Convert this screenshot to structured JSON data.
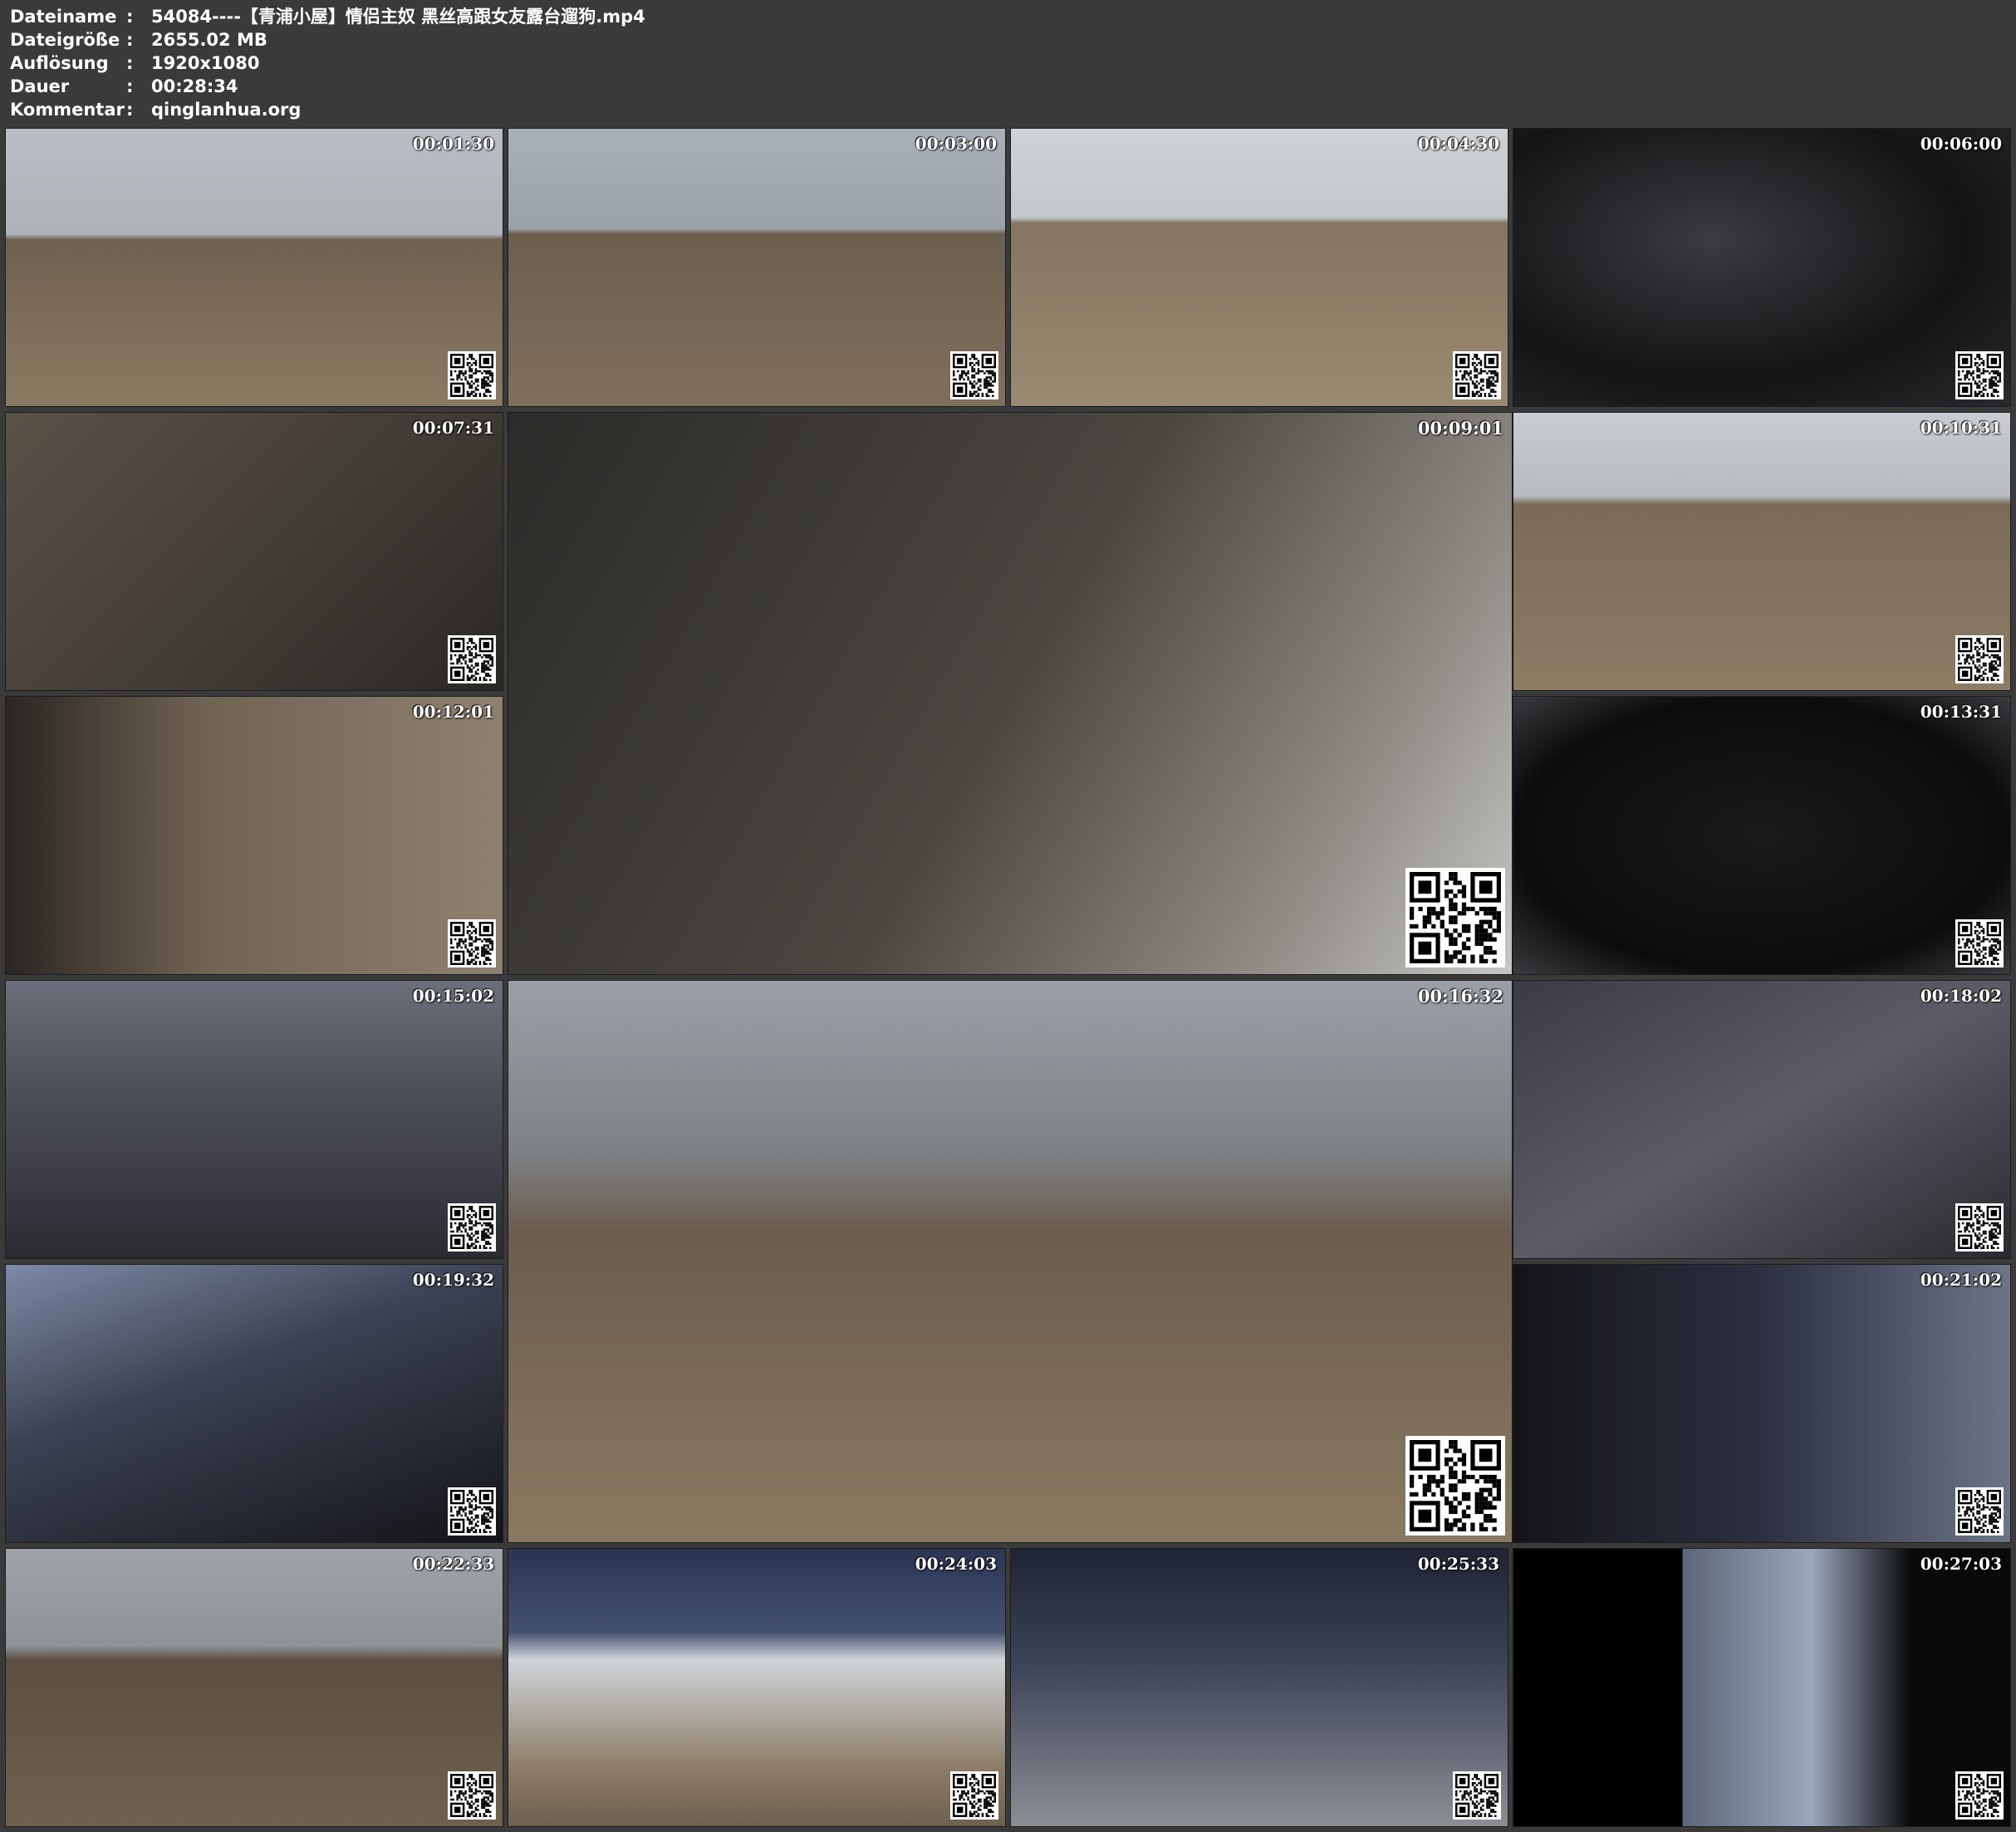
{
  "header": {
    "rows": [
      {
        "key": "Dateiname",
        "sep": ":",
        "value": "54084----【青浦小屋】情侣主奴 黑丝高跟女友露台遛狗.mp4"
      },
      {
        "key": "Dateigröße",
        "sep": ":",
        "value": "2655.02 MB"
      },
      {
        "key": "Auflösung",
        "sep": ":",
        "value": "1920x1080"
      },
      {
        "key": "Dauer",
        "sep": ":",
        "value": "00:28:34"
      },
      {
        "key": "Kommentar",
        "sep": ":",
        "value": "qinglanhua.org"
      }
    ]
  },
  "thumbnails": [
    {
      "time": "00:01:30"
    },
    {
      "time": "00:03:00"
    },
    {
      "time": "00:04:30"
    },
    {
      "time": "00:06:00"
    },
    {
      "time": "00:07:31"
    },
    {
      "time": "00:09:01"
    },
    {
      "time": "00:10:31"
    },
    {
      "time": "00:12:01"
    },
    {
      "time": "00:13:31"
    },
    {
      "time": "00:15:02"
    },
    {
      "time": "00:16:32"
    },
    {
      "time": "00:18:02"
    },
    {
      "time": "00:19:32"
    },
    {
      "time": "00:21:02"
    },
    {
      "time": "00:22:33"
    },
    {
      "time": "00:24:03"
    },
    {
      "time": "00:25:33"
    },
    {
      "time": "00:27:03"
    }
  ],
  "watermark": "qinglanhua.org",
  "colors": {
    "background": "#3a3a3a",
    "text": "#ffffff",
    "floor": "#8a7a63",
    "latex": "#0e0e10",
    "wall": "#c9ccd0"
  }
}
